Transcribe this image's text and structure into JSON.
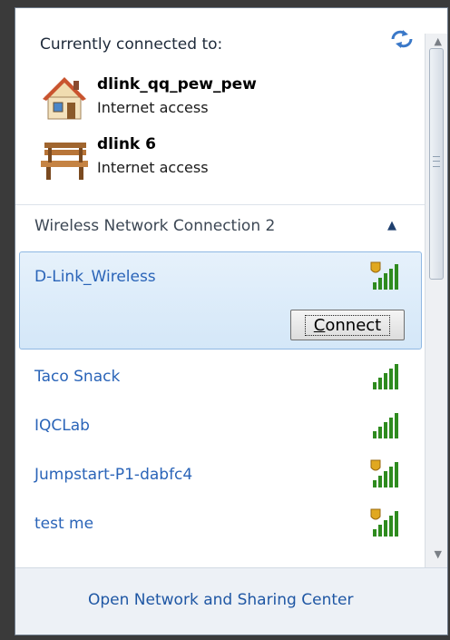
{
  "header": {
    "currently_connected_label": "Currently connected to:"
  },
  "connected": [
    {
      "name": "dlink_qq_pew_pew",
      "status": "Internet access",
      "icon": "home-network-icon"
    },
    {
      "name": "dlink 6",
      "status": "Internet access",
      "icon": "bench-public-network-icon"
    }
  ],
  "section": {
    "title": "Wireless Network Connection 2",
    "collapse_icon": "chevron-up-icon"
  },
  "networks": [
    {
      "name": "D-Link_Wireless",
      "secured": true,
      "signal_bars": 5
    },
    {
      "name": "Taco Snack",
      "secured": false,
      "signal_bars": 5
    },
    {
      "name": "IQCLab",
      "secured": false,
      "signal_bars": 5
    },
    {
      "name": "Jumpstart-P1-dabfc4",
      "secured": true,
      "signal_bars": 5
    },
    {
      "name": "test me",
      "secured": true,
      "signal_bars": 5
    }
  ],
  "selected_network": {
    "connect_label_prefix": "C",
    "connect_label_rest": "onnect"
  },
  "footer": {
    "link": "Open Network and Sharing Center"
  },
  "colors": {
    "link_blue": "#2a64b8",
    "selected_bg": "#d4e7f8",
    "signal_green": "#2e8b1e",
    "shield_gold": "#e0a820"
  }
}
